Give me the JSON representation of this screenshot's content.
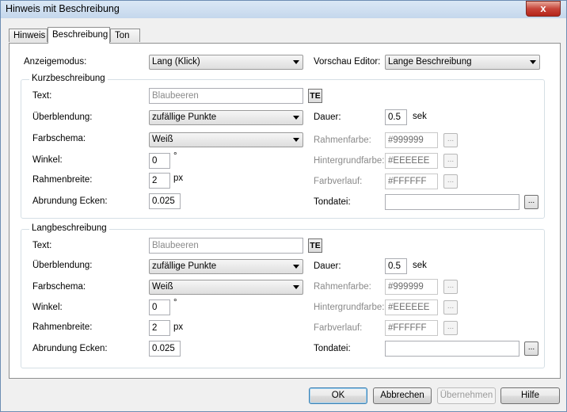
{
  "window": {
    "title": "Hinweis mit Beschreibung",
    "close": "x"
  },
  "tabs": [
    "Hinweis",
    "Beschreibung",
    "Ton"
  ],
  "top": {
    "anzeigemodus_label": "Anzeigemodus:",
    "anzeigemodus_value": "Lang (Klick)",
    "vorschau_label": "Vorschau Editor:",
    "vorschau_value": "Lange Beschreibung"
  },
  "kurz": {
    "title": "Kurzbeschreibung",
    "text_label": "Text:",
    "text_placeholder": "Blaubeeren",
    "te": "TE",
    "ueber_label": "Überblendung:",
    "ueber_value": "zufällige Punkte",
    "dauer_label": "Dauer:",
    "dauer_value": "0.5",
    "dauer_unit": "sek",
    "farb_label": "Farbschema:",
    "farb_value": "Weiß",
    "rahmenfarbe_label": "Rahmenfarbe:",
    "rahmenfarbe_value": "#999999",
    "winkel_label": "Winkel:",
    "winkel_value": "0",
    "winkel_unit": "°",
    "hinter_label": "Hintergrundfarbe:",
    "hinter_value": "#EEEEEE",
    "rahmenbreite_label": "Rahmenbreite:",
    "rahmenbreite_value": "2",
    "rahmenbreite_unit": "px",
    "verlauf_label": "Farbverlauf:",
    "verlauf_value": "#FFFFFF",
    "abrundung_label": "Abrundung Ecken:",
    "abrundung_value": "0.025",
    "tondatei_label": "Tondatei:",
    "tondatei_value": "",
    "dots": "..."
  },
  "lang": {
    "title": "Langbeschreibung",
    "text_label": "Text:",
    "text_placeholder": "Blaubeeren",
    "te": "TE",
    "ueber_label": "Überblendung:",
    "ueber_value": "zufällige Punkte",
    "dauer_label": "Dauer:",
    "dauer_value": "0.5",
    "dauer_unit": "sek",
    "farb_label": "Farbschema:",
    "farb_value": "Weiß",
    "rahmenfarbe_label": "Rahmenfarbe:",
    "rahmenfarbe_value": "#999999",
    "winkel_label": "Winkel:",
    "winkel_value": "0",
    "winkel_unit": "°",
    "hinter_label": "Hintergrundfarbe:",
    "hinter_value": "#EEEEEE",
    "rahmenbreite_label": "Rahmenbreite:",
    "rahmenbreite_value": "2",
    "rahmenbreite_unit": "px",
    "verlauf_label": "Farbverlauf:",
    "verlauf_value": "#FFFFFF",
    "abrundung_label": "Abrundung Ecken:",
    "abrundung_value": "0.025",
    "tondatei_label": "Tondatei:",
    "tondatei_value": "",
    "dots": "..."
  },
  "buttons": {
    "ok": "OK",
    "cancel": "Abbrechen",
    "apply": "Übernehmen",
    "help": "Hilfe"
  }
}
